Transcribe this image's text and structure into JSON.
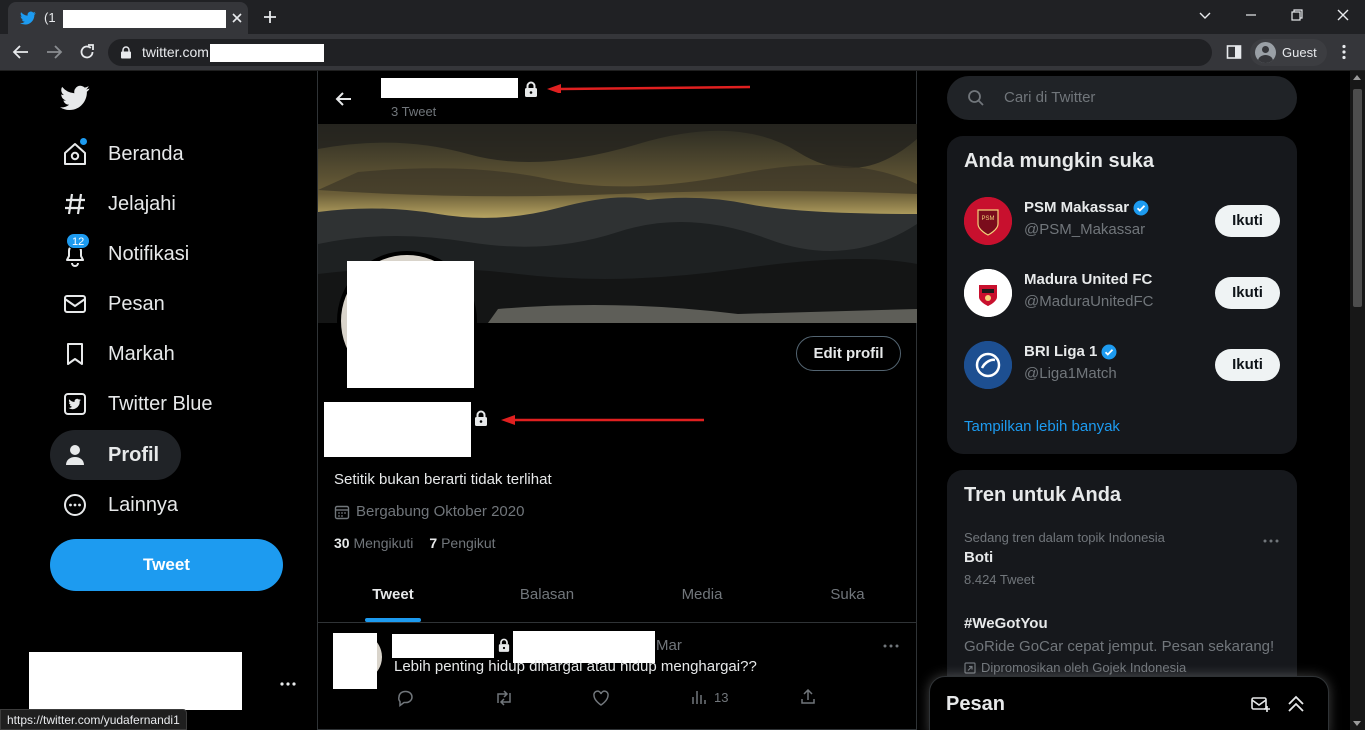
{
  "browser": {
    "tab_title": "(1",
    "url": "twitter.com",
    "profile_label": "Guest",
    "status_url": "https://twitter.com/yudafernandi1"
  },
  "nav": {
    "items": [
      {
        "label": "Beranda",
        "icon": "home-icon"
      },
      {
        "label": "Jelajahi",
        "icon": "hashtag-icon"
      },
      {
        "label": "Notifikasi",
        "icon": "bell-icon",
        "badge": "12"
      },
      {
        "label": "Pesan",
        "icon": "envelope-icon"
      },
      {
        "label": "Markah",
        "icon": "bookmark-icon"
      },
      {
        "label": "Twitter Blue",
        "icon": "twitter-blue-icon"
      },
      {
        "label": "Profil",
        "icon": "person-icon"
      },
      {
        "label": "Lainnya",
        "icon": "more-circle-icon"
      }
    ],
    "tweet_button": "Tweet"
  },
  "profile": {
    "tweet_count": "3 Tweet",
    "edit_button": "Edit profil",
    "bio": "Setitik bukan berarti tidak terlihat",
    "joined": "Bergabung Oktober 2020",
    "following_count": "30",
    "following_label": "Mengikuti",
    "followers_count": "7",
    "followers_label": "Pengikut",
    "tabs": [
      "Tweet",
      "Balasan",
      "Media",
      "Suka"
    ]
  },
  "tweet": {
    "date": "Mar",
    "text": "Lebih penting hidup dihargai atau hidup menghargai??",
    "views": "13"
  },
  "right": {
    "search_placeholder": "Cari di Twitter",
    "suggest_title": "Anda mungkin suka",
    "suggestions": [
      {
        "name": "PSM Makassar",
        "handle": "@PSM_Makassar",
        "verified": true,
        "button": "Ikuti",
        "avatar_color": "#c8102e"
      },
      {
        "name": "Madura United FC",
        "handle": "@MaduraUnitedFC",
        "verified": false,
        "button": "Ikuti",
        "avatar_color": "#ffffff"
      },
      {
        "name": "BRI Liga 1",
        "handle": "@Liga1Match",
        "verified": true,
        "button": "Ikuti",
        "avatar_color": "#1d4f91"
      }
    ],
    "show_more": "Tampilkan lebih banyak",
    "trends_title": "Tren untuk Anda",
    "trends": [
      {
        "context": "Sedang tren dalam topik Indonesia",
        "name": "Boti",
        "meta": "8.424 Tweet"
      },
      {
        "name": "#WeGotYou",
        "desc": "GoRide GoCar cepat jemput. Pesan sekarang!",
        "promo": "Dipromosikan oleh Gojek Indonesia"
      }
    ],
    "messages_title": "Pesan"
  },
  "colors": {
    "accent": "#1d9bf0",
    "background": "#000000",
    "panel": "#16181c"
  }
}
